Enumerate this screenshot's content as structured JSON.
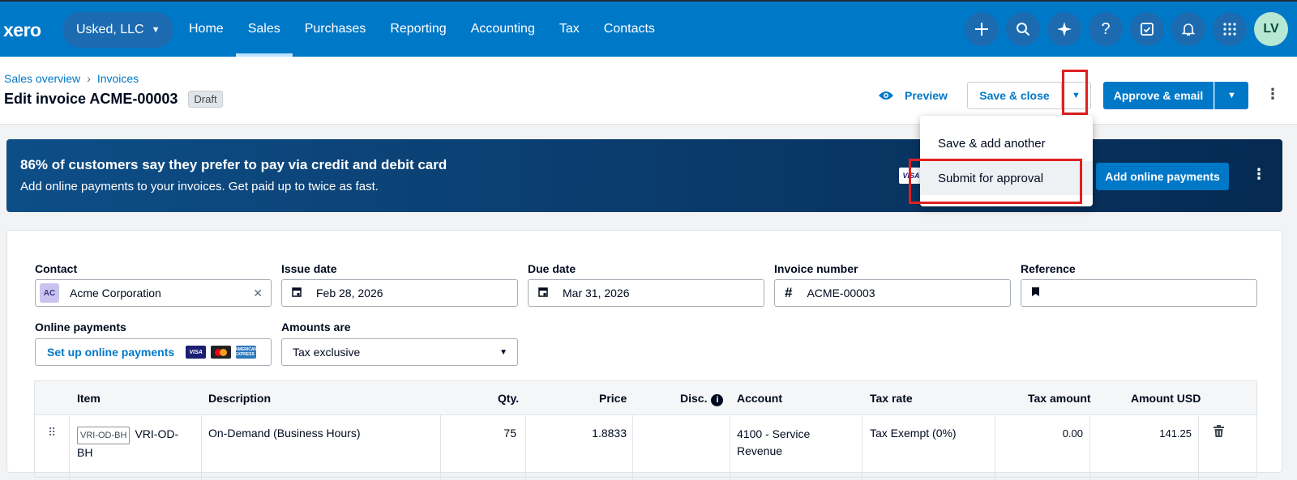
{
  "topbar": {
    "logo": "xero",
    "org_name": "Usked, LLC",
    "nav": [
      "Home",
      "Sales",
      "Purchases",
      "Reporting",
      "Accounting",
      "Tax",
      "Contacts"
    ],
    "active_nav": "Sales",
    "avatar_initials": "LV"
  },
  "header": {
    "breadcrumbs": [
      "Sales overview",
      "Invoices"
    ],
    "title": "Edit invoice ACME-00003",
    "status_badge": "Draft",
    "preview_label": "Preview",
    "save_close_label": "Save & close",
    "approve_email_label": "Approve & email"
  },
  "save_menu": {
    "items": [
      "Save & add another",
      "Submit for approval"
    ]
  },
  "banner": {
    "headline": "86% of customers say they prefer to pay via credit and debit card",
    "subtext": "Add online payments to your invoices. Get paid up to twice as fast.",
    "card_label": "VISA",
    "cta_label": "Add online payments"
  },
  "form": {
    "contact": {
      "label": "Contact",
      "initials": "AC",
      "value": "Acme Corporation"
    },
    "issue_date": {
      "label": "Issue date",
      "value": "Feb 28, 2026"
    },
    "due_date": {
      "label": "Due date",
      "value": "Mar 31, 2026"
    },
    "invoice_number": {
      "label": "Invoice number",
      "value": "ACME-00003"
    },
    "reference": {
      "label": "Reference",
      "value": ""
    },
    "online_payments": {
      "label": "Online payments",
      "link": "Set up online payments",
      "visa": "VISA",
      "amex": "AMERICAN EXPRESS"
    },
    "amounts_are": {
      "label": "Amounts are",
      "value": "Tax exclusive"
    }
  },
  "table": {
    "headers": [
      "Item",
      "Description",
      "Qty.",
      "Price",
      "Disc.",
      "Account",
      "Tax rate",
      "Tax amount",
      "Amount USD"
    ],
    "rows": [
      {
        "item_code": "VRI-OD-BH",
        "item_name_1": "VRI-OD-",
        "item_name_2": "BH",
        "description": "On-Demand (Business Hours)",
        "qty": "75",
        "price": "1.8833",
        "disc": "",
        "account_1": "4100 - Service",
        "account_2": "Revenue",
        "tax_rate": "Tax Exempt (0%)",
        "tax_amount": "0.00",
        "amount": "141.25"
      }
    ]
  },
  "colors": {
    "brand_blue": "#0078c8",
    "highlight_red": "#e02020"
  }
}
